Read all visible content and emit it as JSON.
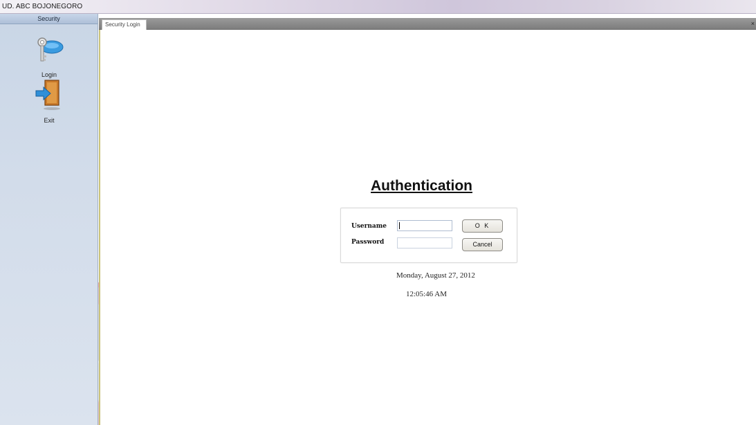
{
  "window": {
    "title": "UD. ABC BOJONEGORO"
  },
  "sidebar": {
    "header": "Security",
    "items": [
      {
        "label": "Login",
        "icon": "key-icon"
      },
      {
        "label": "Exit",
        "icon": "exit-door-icon"
      }
    ]
  },
  "tabs": [
    {
      "label": "Security Login"
    }
  ],
  "tab_close": "×",
  "auth": {
    "title": "Authentication",
    "username_label": "Username",
    "password_label": "Password",
    "username_value": "",
    "password_value": "",
    "ok_label": "O K",
    "cancel_label": "Cancel"
  },
  "status": {
    "date": "Monday, August 27, 2012",
    "time": "12:05:46 AM"
  },
  "colors": {
    "watermark_red": "#e8a0a3",
    "watermark_gray": "#cfcfcf",
    "content_border": "#c9c27a"
  }
}
